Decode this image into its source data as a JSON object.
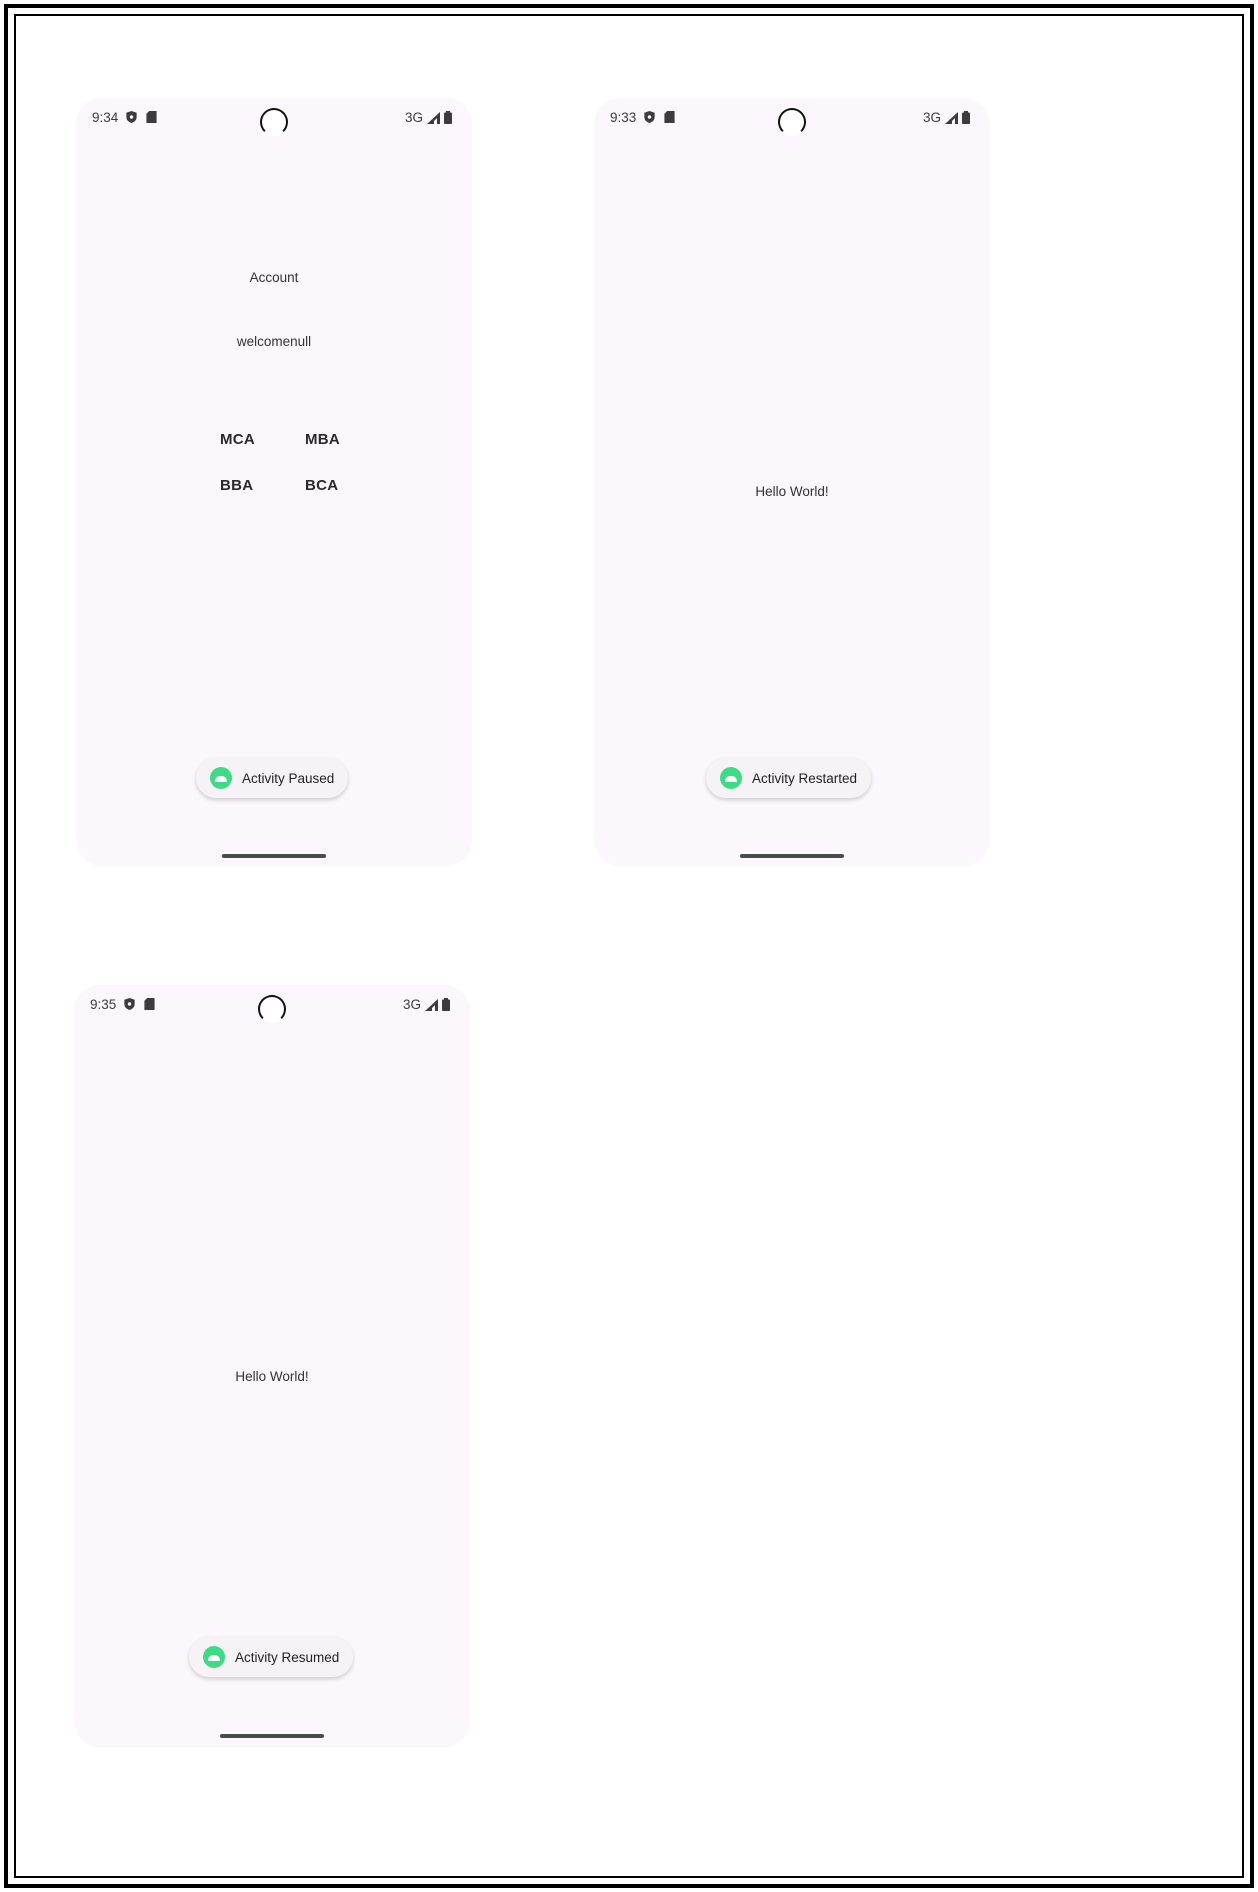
{
  "phones": [
    {
      "status": {
        "time": "9:34",
        "network": "3G"
      },
      "title": "Account",
      "subtitle": "welcomenull",
      "buttons": [
        "MCA",
        "MBA",
        "BBA",
        "BCA"
      ],
      "toast": "Activity Paused"
    },
    {
      "status": {
        "time": "9:33",
        "network": "3G"
      },
      "message": "Hello World!",
      "toast": "Activity Restarted"
    },
    {
      "status": {
        "time": "9:35",
        "network": "3G"
      },
      "message": "Hello World!",
      "toast": "Activity Resumed"
    }
  ],
  "icons": {
    "shield": "shield-icon",
    "sdcard": "sd-card-icon",
    "signal": "signal-icon",
    "battery": "battery-icon",
    "toast_icon": "android-icon"
  },
  "colors": {
    "phone_bg": "#fcf6fd",
    "toast_icon": "#3ddc84"
  }
}
